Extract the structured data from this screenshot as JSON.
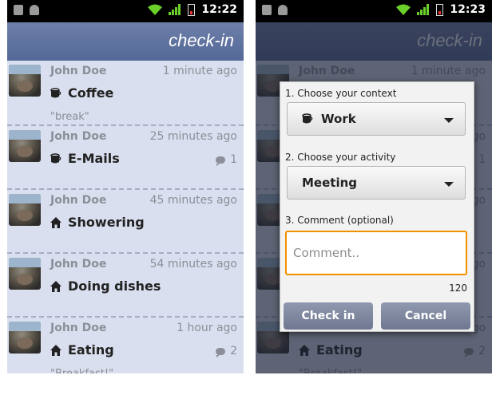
{
  "status_bar_left": {
    "time": "12:22"
  },
  "status_bar_right": {
    "time": "12:23"
  },
  "app": {
    "title": "check-in"
  },
  "feed_left": [
    {
      "name": "John Doe",
      "time": "1 minute ago",
      "context_icon": "coffee-cup-icon",
      "activity": "Coffee",
      "comment": "\"break\"",
      "comment_count": ""
    },
    {
      "name": "John Doe",
      "time": "25 minutes ago",
      "context_icon": "coffee-cup-icon",
      "activity": "E-Mails",
      "comment": "",
      "comment_count": "1"
    },
    {
      "name": "John Doe",
      "time": "45 minutes ago",
      "context_icon": "home-icon",
      "activity": "Showering",
      "comment": "",
      "comment_count": ""
    },
    {
      "name": "John Doe",
      "time": "54 minutes ago",
      "context_icon": "home-icon",
      "activity": "Doing dishes",
      "comment": "",
      "comment_count": ""
    },
    {
      "name": "John Doe",
      "time": "1 hour ago",
      "context_icon": "home-icon",
      "activity": "Eating",
      "comment": "\"Breakfast!\"",
      "comment_count": "2"
    }
  ],
  "feed_right": [
    {
      "name": "John Doe",
      "time": "1 minute ago",
      "context_icon": "coffee-cup-icon",
      "activity": "",
      "comment": "",
      "comment_count": ""
    },
    {
      "name": "",
      "time": "ago",
      "context_icon": "",
      "activity": "",
      "comment": "",
      "comment_count": "1"
    },
    {
      "name": "",
      "time": "ago",
      "context_icon": "",
      "activity": "",
      "comment": "",
      "comment_count": ""
    },
    {
      "name": "",
      "time": "ago",
      "context_icon": "",
      "activity": "",
      "comment": "",
      "comment_count": ""
    },
    {
      "name": "",
      "time": "ago",
      "context_icon": "home-icon",
      "activity": "Eating",
      "comment": "\"Breakfast!\"",
      "comment_count": "2"
    }
  ],
  "dialog": {
    "context_label": "1. Choose your context",
    "context_value": "Work",
    "context_icon": "coffee-cup-icon",
    "activity_label": "2. Choose your activity",
    "activity_value": "Meeting",
    "comment_label": "3. Comment (optional)",
    "comment_placeholder": "Comment..",
    "comment_value": "",
    "char_counter": "120",
    "checkin_button": "Check in",
    "cancel_button": "Cancel"
  },
  "colors": {
    "title_bar": "#5f71a0",
    "list_background": "#d9dfee",
    "focus_accent": "#f29100",
    "dialog_button": "#7f889f"
  }
}
